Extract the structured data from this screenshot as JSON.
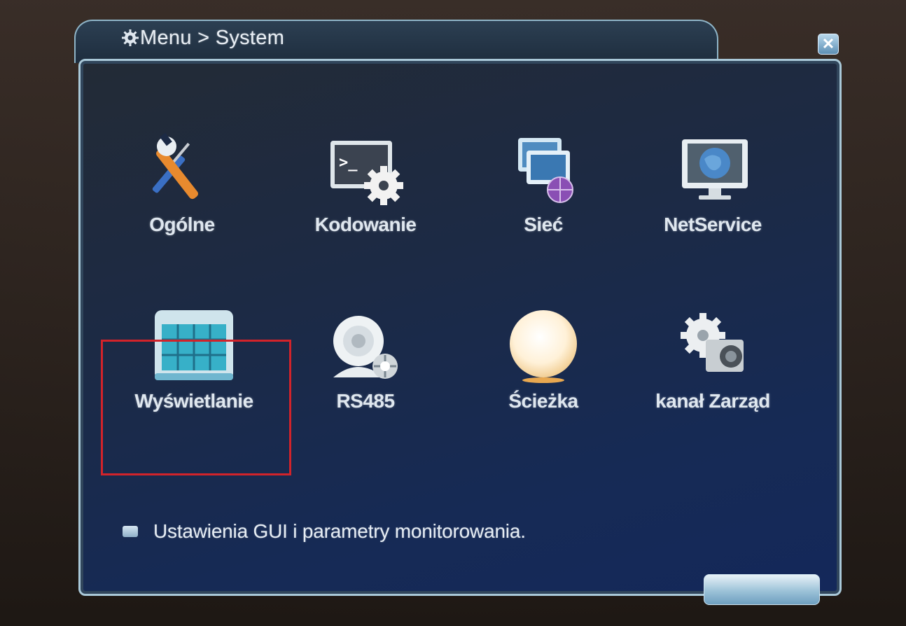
{
  "window": {
    "title": "Menu > System",
    "close_glyph": "✕"
  },
  "tiles": [
    {
      "label": "Ogólne",
      "icon": "tools-icon"
    },
    {
      "label": "Kodowanie",
      "icon": "terminal-gear-icon"
    },
    {
      "label": "Sieć",
      "icon": "network-icon"
    },
    {
      "label": "NetService",
      "icon": "monitor-globe-icon"
    },
    {
      "label": "Wyświetlanie",
      "icon": "display-grid-icon",
      "selected": true
    },
    {
      "label": "RS485",
      "icon": "ptz-camera-icon"
    },
    {
      "label": "Ścieżka",
      "icon": "sphere-icon"
    },
    {
      "label": "kanał Zarząd",
      "icon": "camera-gear-icon"
    }
  ],
  "status": {
    "text": "Ustawienia GUI i parametry monitorowania."
  },
  "colors": {
    "selection": "#d2232a",
    "panel_border": "#a9c8d8",
    "panel_bg": "#1c2a45"
  }
}
